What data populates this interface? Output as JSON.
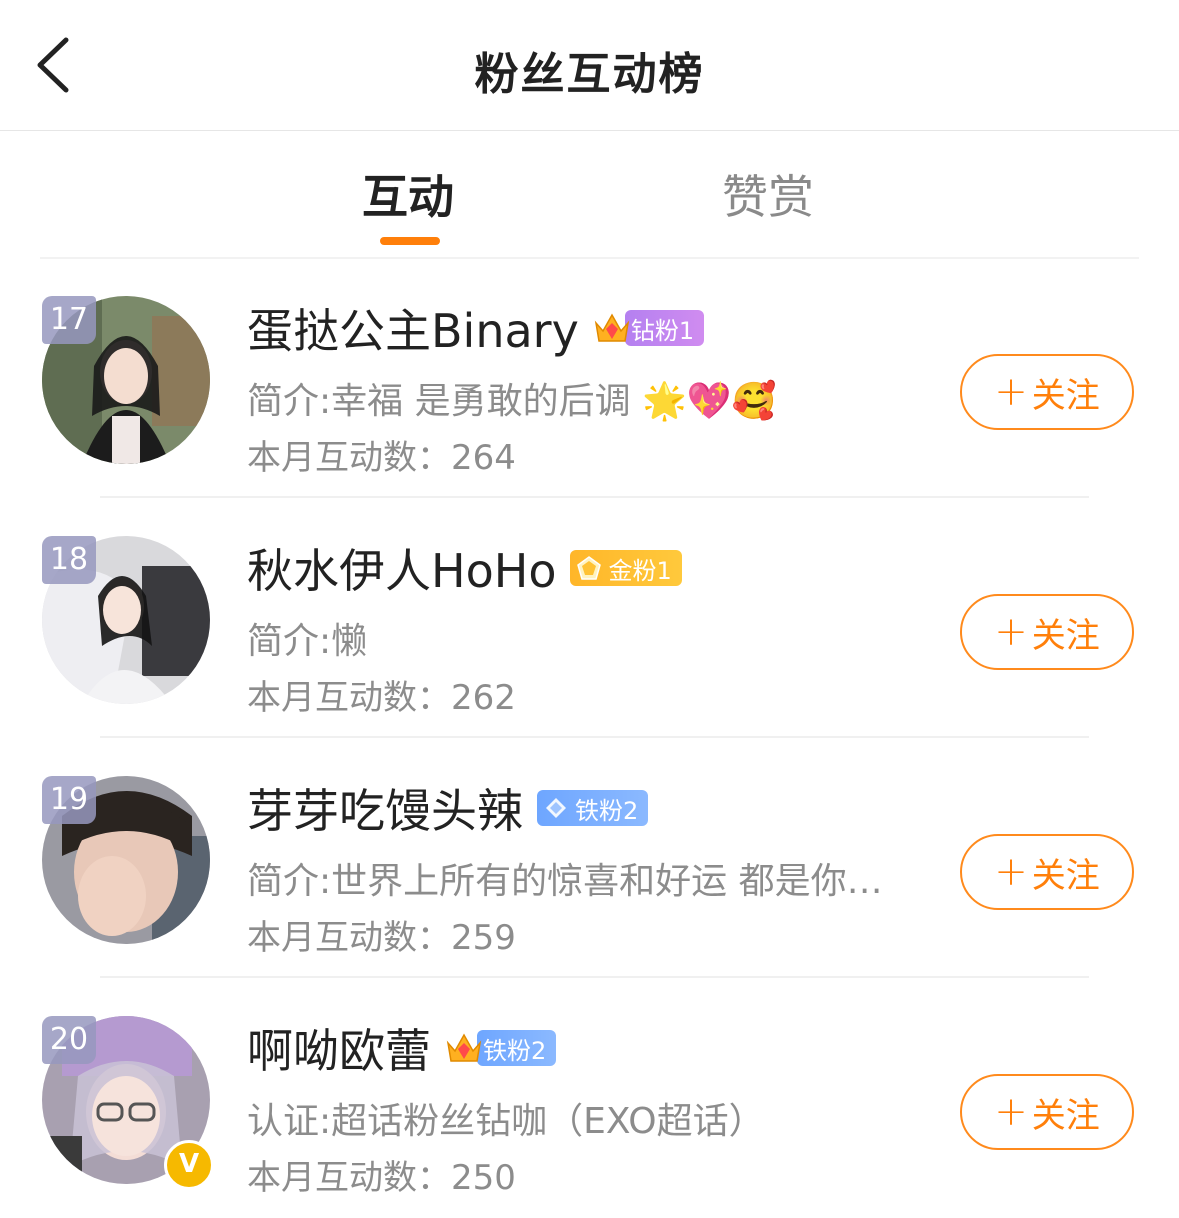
{
  "header": {
    "title": "粉丝互动榜",
    "back_icon": "chevron-left-icon"
  },
  "tabs": [
    {
      "label": "互动",
      "active": true
    },
    {
      "label": "赞赏",
      "active": false
    }
  ],
  "colors": {
    "accent": "#ff7f0a"
  },
  "follow_label": "关注",
  "follow_plus": "+",
  "fans": [
    {
      "rank": "17",
      "name": "蛋挞公主Binary",
      "crown_level": "3",
      "badge": "钻粉1",
      "badge_color": "#c284f0",
      "bio": "简介:幸福 是勇敢的后调 🌟💖🥰",
      "count": "本月互动数：264"
    },
    {
      "rank": "18",
      "name": "秋水伊人HoHo",
      "badge": "金粉1",
      "badge_color": "#ffb629",
      "bio": "简介:懒",
      "count": "本月互动数：262"
    },
    {
      "rank": "19",
      "name": "芽芽吃馒头辣",
      "badge": "铁粉2",
      "badge_color": "#6ea6ff",
      "bio": "简介:世界上所有的惊喜和好运 都是你累…",
      "count": "本月互动数：259"
    },
    {
      "rank": "20",
      "name": "啊呦欧蕾",
      "crown_level": "5",
      "badge": "铁粉2",
      "badge_color": "#6ea6ff",
      "bio": "认证:超话粉丝钻咖（EXO超话）",
      "count": "本月互动数：250",
      "verified": "V"
    }
  ]
}
